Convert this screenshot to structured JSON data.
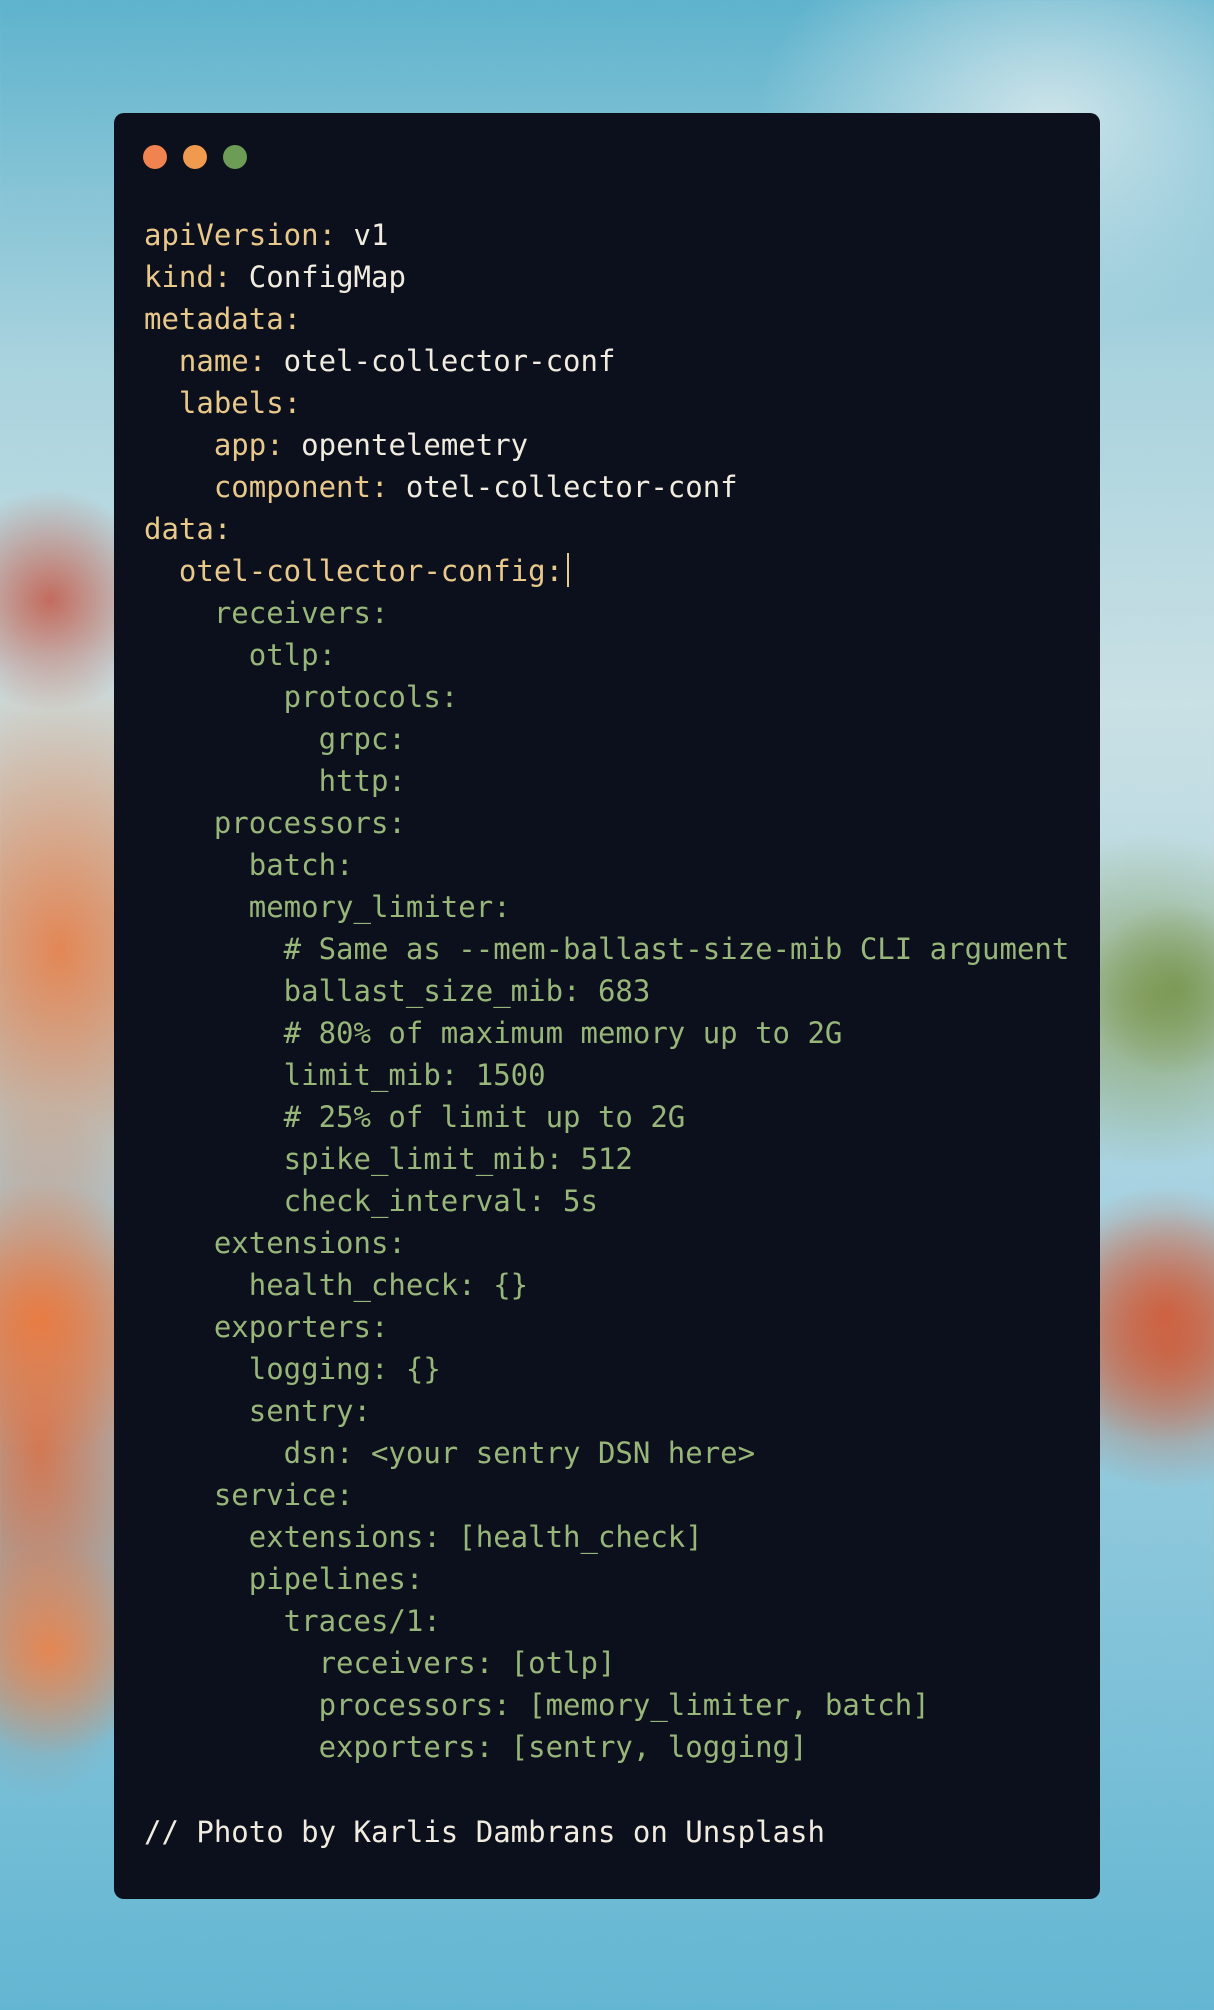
{
  "window": {
    "controls": [
      {
        "name": "close",
        "color": "#f0834f"
      },
      {
        "name": "minimize",
        "color": "#f09a4f"
      },
      {
        "name": "maximize",
        "color": "#6d9c56"
      }
    ]
  },
  "code_lines": [
    [
      {
        "k": "key",
        "t": "apiVersion:"
      },
      {
        "k": "val",
        "t": " v1"
      }
    ],
    [
      {
        "k": "key",
        "t": "kind:"
      },
      {
        "k": "val",
        "t": " ConfigMap"
      }
    ],
    [
      {
        "k": "key",
        "t": "metadata:"
      }
    ],
    [
      {
        "k": "key",
        "t": "  name:"
      },
      {
        "k": "val",
        "t": " otel-collector-conf"
      }
    ],
    [
      {
        "k": "key",
        "t": "  labels:"
      }
    ],
    [
      {
        "k": "key",
        "t": "    app:"
      },
      {
        "k": "val",
        "t": " opentelemetry"
      }
    ],
    [
      {
        "k": "key",
        "t": "    component:"
      },
      {
        "k": "val",
        "t": " otel-collector-conf"
      }
    ],
    [
      {
        "k": "key",
        "t": "data:"
      }
    ],
    [
      {
        "k": "key",
        "t": "  otel-collector-config:"
      },
      {
        "k": "cursor",
        "t": ""
      }
    ],
    [
      {
        "k": "str",
        "t": "    receivers:"
      }
    ],
    [
      {
        "k": "str",
        "t": "      otlp:"
      }
    ],
    [
      {
        "k": "str",
        "t": "        protocols:"
      }
    ],
    [
      {
        "k": "str",
        "t": "          grpc:"
      }
    ],
    [
      {
        "k": "str",
        "t": "          http:"
      }
    ],
    [
      {
        "k": "str",
        "t": "    processors:"
      }
    ],
    [
      {
        "k": "str",
        "t": "      batch:"
      }
    ],
    [
      {
        "k": "str",
        "t": "      memory_limiter:"
      }
    ],
    [
      {
        "k": "str",
        "t": "        # Same as --mem-ballast-size-mib CLI argument"
      }
    ],
    [
      {
        "k": "str",
        "t": "        ballast_size_mib: 683"
      }
    ],
    [
      {
        "k": "str",
        "t": "        # 80% of maximum memory up to 2G"
      }
    ],
    [
      {
        "k": "str",
        "t": "        limit_mib: 1500"
      }
    ],
    [
      {
        "k": "str",
        "t": "        # 25% of limit up to 2G"
      }
    ],
    [
      {
        "k": "str",
        "t": "        spike_limit_mib: 512"
      }
    ],
    [
      {
        "k": "str",
        "t": "        check_interval: 5s"
      }
    ],
    [
      {
        "k": "str",
        "t": "    extensions:"
      }
    ],
    [
      {
        "k": "str",
        "t": "      health_check: {}"
      }
    ],
    [
      {
        "k": "str",
        "t": "    exporters:"
      }
    ],
    [
      {
        "k": "str",
        "t": "      logging: {}"
      }
    ],
    [
      {
        "k": "str",
        "t": "      sentry:"
      }
    ],
    [
      {
        "k": "str",
        "t": "        dsn: <your sentry DSN here>"
      }
    ],
    [
      {
        "k": "str",
        "t": "    service:"
      }
    ],
    [
      {
        "k": "str",
        "t": "      extensions: [health_check]"
      }
    ],
    [
      {
        "k": "str",
        "t": "      pipelines:"
      }
    ],
    [
      {
        "k": "str",
        "t": "        traces/1:"
      }
    ],
    [
      {
        "k": "str",
        "t": "          receivers: [otlp]"
      }
    ],
    [
      {
        "k": "str",
        "t": "          processors: [memory_limiter, batch]"
      }
    ],
    [
      {
        "k": "str",
        "t": "          exporters: [sentry, logging]"
      }
    ]
  ],
  "footer": "// Photo by Karlis Dambrans on Unsplash",
  "colors": {
    "window_bg": "#0b101c",
    "key": "#e9c98b",
    "value": "#f1ece0",
    "string_block": "#98b679"
  }
}
